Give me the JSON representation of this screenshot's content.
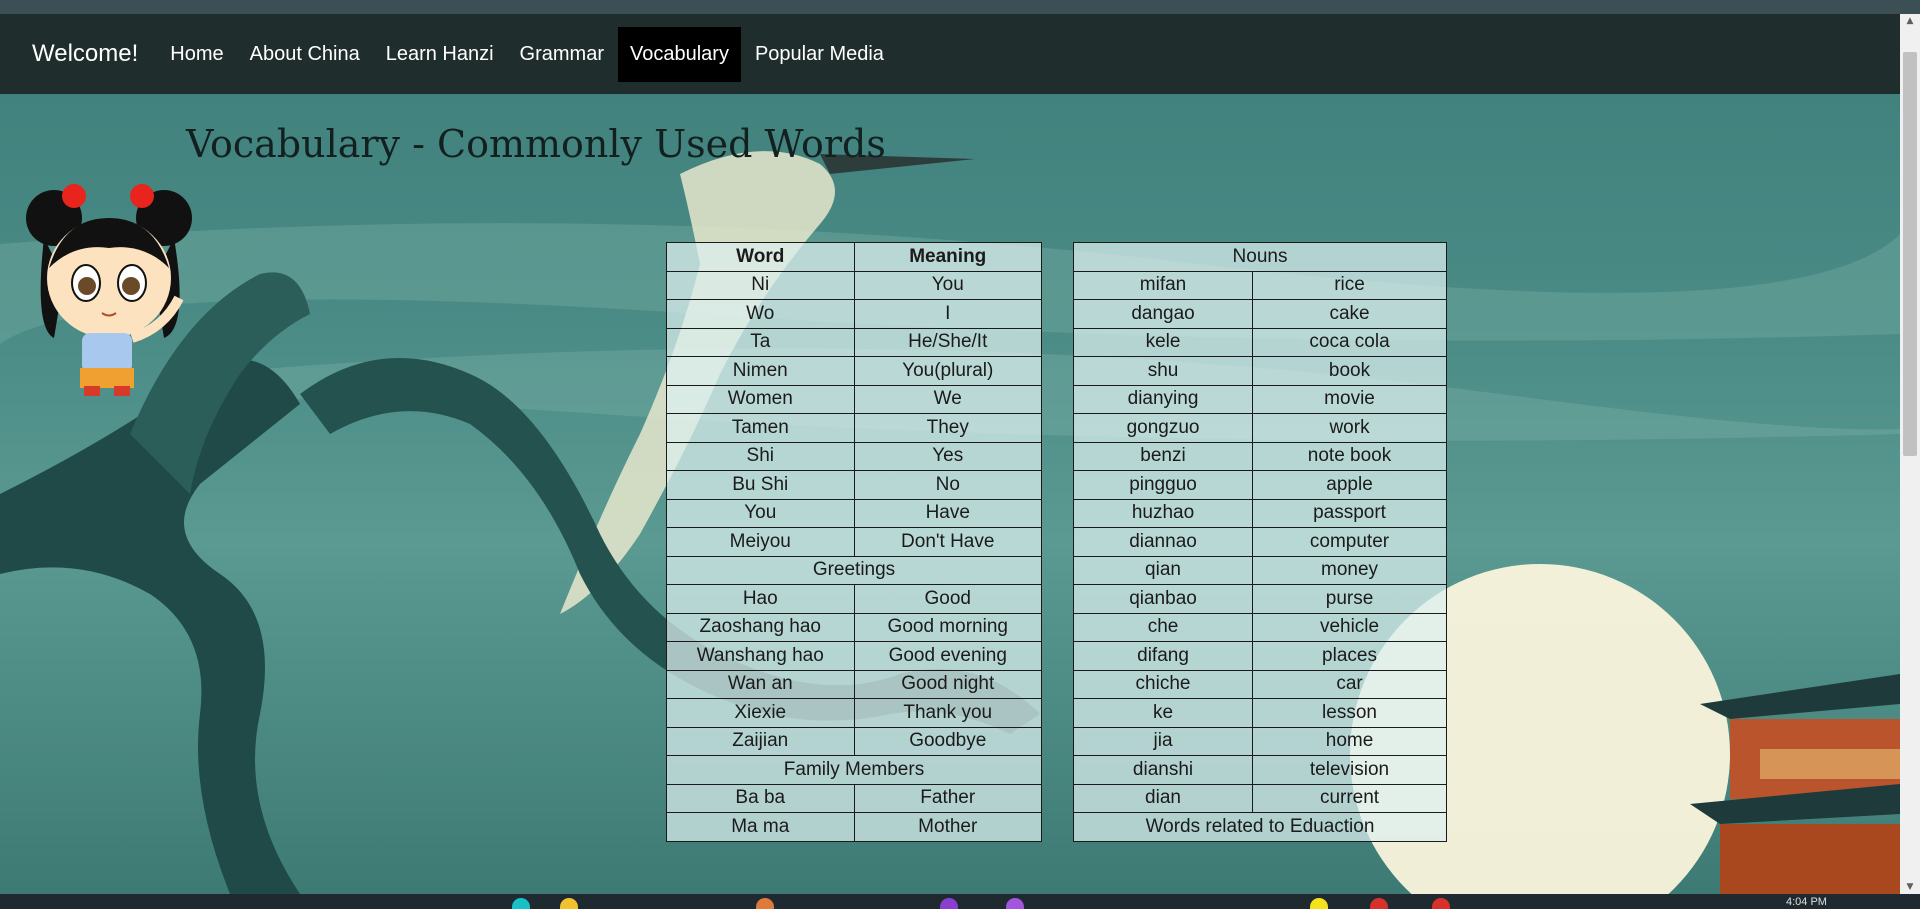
{
  "navbar": {
    "brand": "Welcome!",
    "items": [
      {
        "label": "Home"
      },
      {
        "label": "About China"
      },
      {
        "label": "Learn Hanzi"
      },
      {
        "label": "Grammar"
      },
      {
        "label": "Vocabulary"
      },
      {
        "label": "Popular Media"
      }
    ],
    "active": "Vocabulary"
  },
  "page": {
    "heading": "Vocabulary - Commonly Used Words"
  },
  "table_left": {
    "headers": [
      "Word",
      "Meaning"
    ],
    "rows": [
      [
        "Ni",
        "You"
      ],
      [
        "Wo",
        "I"
      ],
      [
        "Ta",
        "He/She/It"
      ],
      [
        "Nimen",
        "You(plural)"
      ],
      [
        "Women",
        "We"
      ],
      [
        "Tamen",
        "They"
      ],
      [
        "Shi",
        "Yes"
      ],
      [
        "Bu Shi",
        "No"
      ],
      [
        "You",
        "Have"
      ],
      [
        "Meiyou",
        "Don't Have"
      ]
    ],
    "section_greetings": "Greetings",
    "greetings": [
      [
        "Hao",
        "Good"
      ],
      [
        "Zaoshang hao",
        "Good morning"
      ],
      [
        "Wanshang hao",
        "Good evening"
      ],
      [
        "Wan an",
        "Good night"
      ],
      [
        "Xiexie",
        "Thank you"
      ],
      [
        "Zaijian",
        "Goodbye"
      ]
    ],
    "section_family": "Family Members",
    "family": [
      [
        "Ba ba",
        "Father"
      ],
      [
        "Ma ma",
        "Mother"
      ]
    ]
  },
  "table_right": {
    "header": "Nouns",
    "rows": [
      [
        "mifan",
        "rice"
      ],
      [
        "dangao",
        "cake"
      ],
      [
        "kele",
        "coca cola"
      ],
      [
        "shu",
        "book"
      ],
      [
        "dianying",
        "movie"
      ],
      [
        "gongzuo",
        "work"
      ],
      [
        "benzi",
        "note book"
      ],
      [
        "pingguo",
        "apple"
      ],
      [
        "huzhao",
        "passport"
      ],
      [
        "diannao",
        "computer"
      ],
      [
        "qian",
        "money"
      ],
      [
        "qianbao",
        "purse"
      ],
      [
        "che",
        "vehicle"
      ],
      [
        "difang",
        "places"
      ],
      [
        "chiche",
        "car"
      ],
      [
        "ke",
        "lesson"
      ],
      [
        "jia",
        "home"
      ],
      [
        "dianshi",
        "television"
      ],
      [
        "dian",
        "current"
      ]
    ],
    "section_education": "Words related to Eduaction"
  },
  "taskbar": {
    "time": "4:04 PM"
  },
  "colors": {
    "navbar": "#1f2e2c",
    "active_tab": "#000000",
    "background_teal": "#4b8b86",
    "moon": "#fbf4dc"
  }
}
